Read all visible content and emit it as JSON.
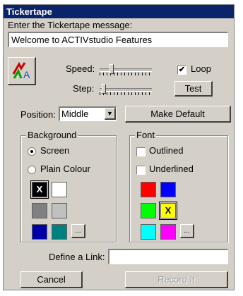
{
  "window": {
    "title": "Tickertape"
  },
  "message": {
    "label": "Enter the Tickertape message:",
    "value": "Welcome to ACTIVstudio Features"
  },
  "speed": {
    "label": "Speed:",
    "level": 0.2
  },
  "step": {
    "label": "Step:",
    "level": 0.05
  },
  "loop": {
    "label": "Loop",
    "checked": true,
    "mark": "✔"
  },
  "test_button": "Test",
  "position": {
    "label": "Position:",
    "value": "Middle"
  },
  "make_default_button": "Make Default",
  "background": {
    "title": "Background",
    "screen_label": "Screen",
    "plain_colour_label": "Plain Colour",
    "selected": "Screen",
    "swatches": [
      "#000000",
      "#ffffff",
      "#808080",
      "#c0c0c0",
      "#0000a8",
      "#008080"
    ],
    "selected_swatch_mark": "X",
    "more_button": "..."
  },
  "font": {
    "title": "Font",
    "outlined_label": "Outlined",
    "underlined_label": "Underlined",
    "swatches": [
      "#ff0000",
      "#0000ff",
      "#00ff00",
      "#ffff00",
      "#00ffff",
      "#ff00ff"
    ],
    "selected_swatch_mark": "X",
    "more_button": "..."
  },
  "link": {
    "label": "Define a Link:",
    "value": ""
  },
  "cancel_button": "Cancel",
  "record_button": "Record It"
}
